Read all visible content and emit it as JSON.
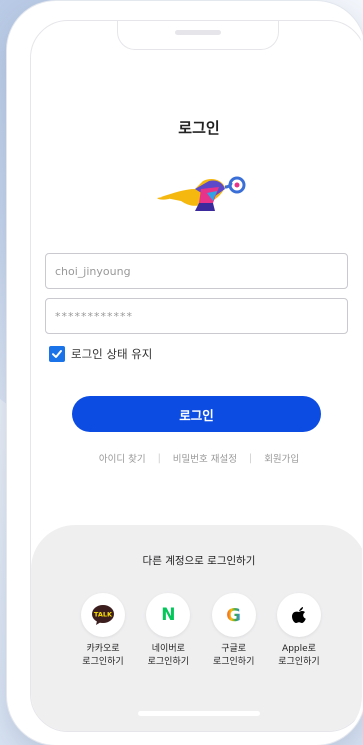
{
  "header": {
    "title": "로그인"
  },
  "form": {
    "id_value": "choi_jinyoung",
    "password_value": "************",
    "keep_login_label": "로그인 상태 유지",
    "keep_login_checked": true,
    "login_button": "로그인"
  },
  "links": {
    "find_id": "아이디 찾기",
    "reset_password": "비밀번호 재설정",
    "signup": "회원가입",
    "separator": "|"
  },
  "alternate": {
    "title": "다른 계정으로 로그인하기",
    "providers": [
      {
        "label": "카카오로\n로그인하기",
        "icon": "kakao-talk-icon",
        "icon_text": "TALK",
        "color": "#3c1e1e"
      },
      {
        "label": "네이버로\n로그인하기",
        "icon": "naver-icon",
        "icon_text": "N",
        "color": "#03c75a"
      },
      {
        "label": "구글로\n로그인하기",
        "icon": "google-icon",
        "icon_text": "G",
        "color": "#4285f4"
      },
      {
        "label": "Apple로\n로그인하기",
        "icon": "apple-icon",
        "color": "#000000"
      }
    ]
  },
  "colors": {
    "primary": "#0c4ce3",
    "checkbox": "#1a73e8"
  }
}
